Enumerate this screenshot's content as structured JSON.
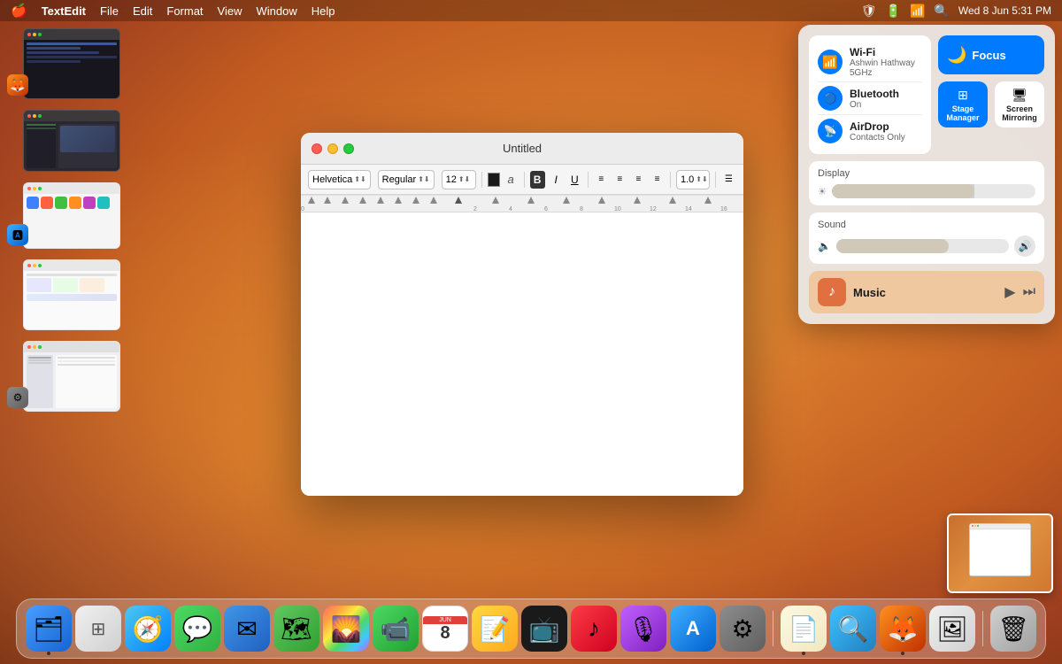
{
  "menubar": {
    "apple": "🍎",
    "app_name": "TextEdit",
    "menus": [
      "File",
      "Edit",
      "Format",
      "View",
      "Window",
      "Help"
    ],
    "right_items": [
      "shield_icon",
      "battery_icon",
      "wifi_icon",
      "search_icon",
      "date_time"
    ],
    "date_time": "Wed 8 Jun  5:31 PM"
  },
  "textedit_window": {
    "title": "Untitled",
    "font": "Helvetica",
    "style": "Regular",
    "size": "12",
    "line_spacing": "1.0"
  },
  "control_center": {
    "wifi": {
      "label": "Wi-Fi",
      "network": "Ashwin Hathway 5GHz"
    },
    "bluetooth": {
      "label": "Bluetooth",
      "status": "On"
    },
    "airdrop": {
      "label": "AirDrop",
      "status": "Contacts Only"
    },
    "focus": {
      "label": "Focus"
    },
    "stage_manager": {
      "label": "Stage Manager"
    },
    "screen_mirroring": {
      "label": "Screen Mirroring"
    },
    "display": {
      "label": "Display",
      "brightness": 70
    },
    "sound": {
      "label": "Sound",
      "volume": 65
    },
    "music": {
      "label": "Music"
    }
  },
  "dock": {
    "items": [
      {
        "name": "Finder",
        "emoji": "🗂"
      },
      {
        "name": "Launchpad",
        "emoji": "⋮⋮"
      },
      {
        "name": "Safari",
        "emoji": "🧭"
      },
      {
        "name": "Messages",
        "emoji": "💬"
      },
      {
        "name": "Mail",
        "emoji": "✉"
      },
      {
        "name": "Maps",
        "emoji": "🗺"
      },
      {
        "name": "Photos",
        "emoji": "🌄"
      },
      {
        "name": "FaceTime",
        "emoji": "📹"
      },
      {
        "name": "Calendar",
        "emoji": "📅"
      },
      {
        "name": "Notes",
        "emoji": "📝"
      },
      {
        "name": "AppleTV",
        "emoji": "📺"
      },
      {
        "name": "Music",
        "emoji": "♪"
      },
      {
        "name": "Podcasts",
        "emoji": "🎙"
      },
      {
        "name": "AppStore",
        "emoji": "🅰"
      },
      {
        "name": "Settings",
        "emoji": "⚙"
      },
      {
        "name": "TextEdit",
        "emoji": "📄"
      },
      {
        "name": "Proxyman",
        "emoji": "🔍"
      },
      {
        "name": "Firefox",
        "emoji": "🦊"
      },
      {
        "name": "Preview",
        "emoji": "🖼"
      },
      {
        "name": "Trash",
        "emoji": "🗑"
      }
    ]
  }
}
